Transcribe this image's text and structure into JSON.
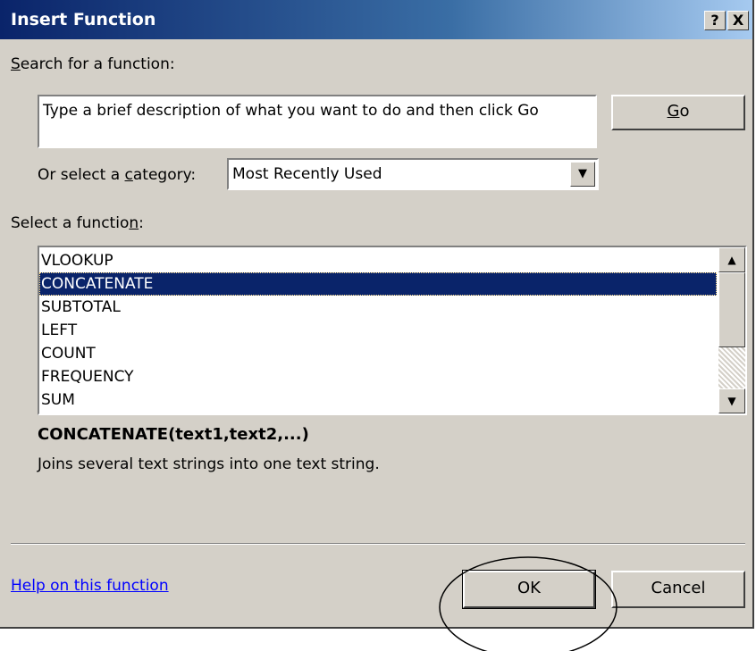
{
  "dialog": {
    "title": "Insert Function",
    "help_glyph": "?",
    "close_glyph": "X"
  },
  "search": {
    "label_prefix": "",
    "label_access": "S",
    "label_rest": "earch for a function:",
    "value": "Type a brief description of what you want to do and then click Go",
    "go_access": "G",
    "go_rest": "o"
  },
  "category": {
    "label_before": "Or select a ",
    "label_access": "c",
    "label_after": "ategory:",
    "selected": "Most Recently Used",
    "arrow_glyph": "▼"
  },
  "functions": {
    "label_before": "Select a functio",
    "label_access": "n",
    "label_after": ":",
    "items": [
      "VLOOKUP",
      "CONCATENATE",
      "SUBTOTAL",
      "LEFT",
      "COUNT",
      "FREQUENCY",
      "SUM"
    ],
    "selected_index": 1,
    "scroll_up_glyph": "▲",
    "scroll_down_glyph": "▼"
  },
  "details": {
    "signature": "CONCATENATE(text1,text2,...)",
    "description": "Joins several text strings into one text string."
  },
  "footer": {
    "help_link": "Help on this function",
    "ok": "OK",
    "cancel": "Cancel"
  },
  "colors": {
    "face": "#d4d0c8",
    "selection": "#0a246a",
    "link": "#0000ff"
  }
}
